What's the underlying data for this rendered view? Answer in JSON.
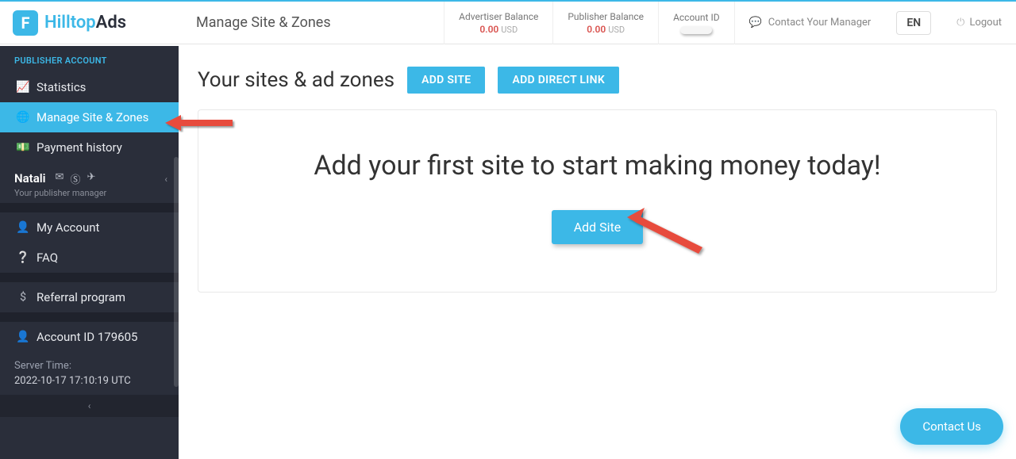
{
  "logo": {
    "part1": "Hilltop",
    "part2": "Ads",
    "icon": "F"
  },
  "page_title": "Manage Site & Zones",
  "header": {
    "advertiser_label": "Advertiser Balance",
    "advertiser_amount": "0.00",
    "advertiser_currency": "USD",
    "publisher_label": "Publisher Balance",
    "publisher_amount": "0.00",
    "publisher_currency": "USD",
    "account_id_label": "Account ID",
    "contact_manager": "Contact Your Manager",
    "language": "EN",
    "logout": "Logout"
  },
  "sidebar": {
    "section_header": "PUBLISHER ACCOUNT",
    "items": [
      {
        "label": "Statistics"
      },
      {
        "label": "Manage Site & Zones"
      },
      {
        "label": "Payment history"
      }
    ],
    "manager_name": "Natali",
    "manager_sub": "Your publisher manager",
    "my_account": "My Account",
    "faq": "FAQ",
    "referral": "Referral program",
    "account_id": "Account ID 179605",
    "server_time_label": "Server Time:",
    "server_time_value": "2022-10-17 17:10:19 UTC"
  },
  "main": {
    "title": "Your sites & ad zones",
    "add_site_btn": "ADD SITE",
    "add_direct_btn": "ADD DIRECT LINK",
    "panel_heading": "Add your first site to start making money today!",
    "panel_btn": "Add Site"
  },
  "contact_us": "Contact Us"
}
